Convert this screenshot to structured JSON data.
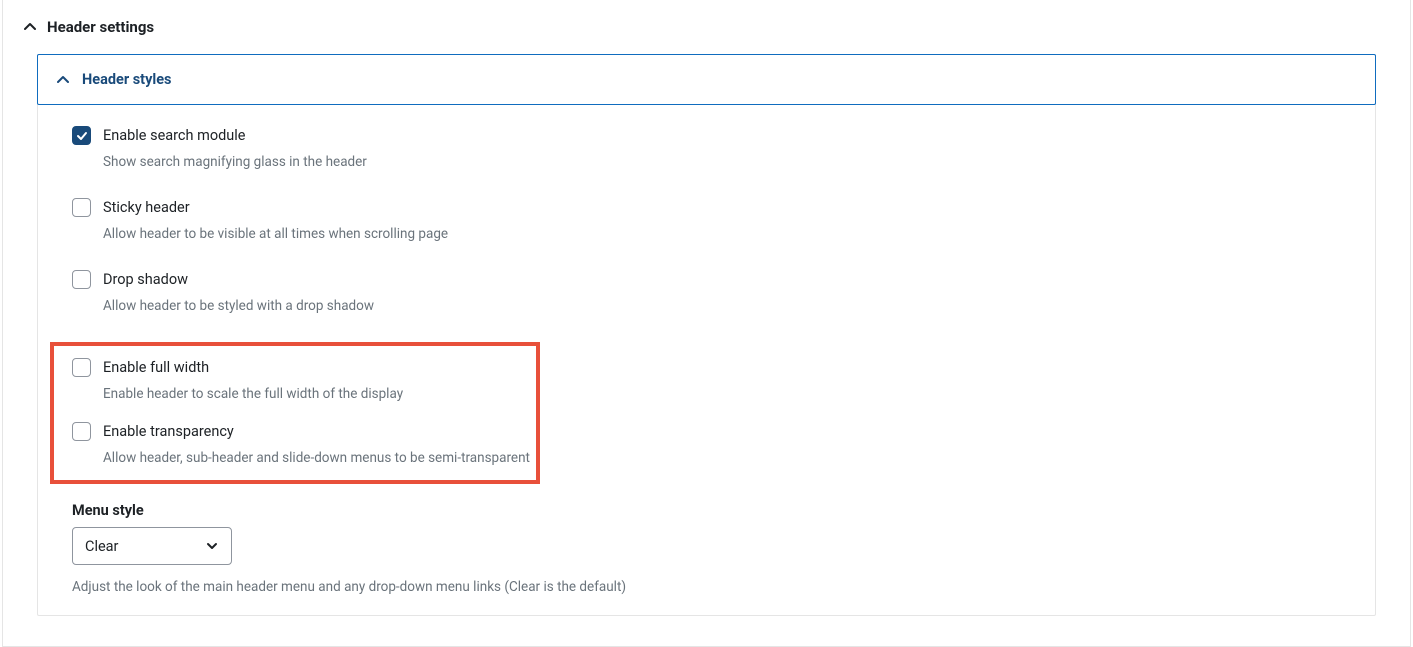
{
  "header": {
    "title": "Header settings"
  },
  "sub": {
    "title": "Header styles"
  },
  "options": {
    "enable_search": {
      "label": "Enable search module",
      "desc": "Show search magnifying glass in the header",
      "checked": true
    },
    "sticky_header": {
      "label": "Sticky header",
      "desc": "Allow header to be visible at all times when scrolling page",
      "checked": false
    },
    "drop_shadow": {
      "label": "Drop shadow",
      "desc": "Allow header to be styled with a drop shadow",
      "checked": false
    },
    "full_width": {
      "label": "Enable full width",
      "desc": "Enable header to scale the full width of the display",
      "checked": false
    },
    "transparency": {
      "label": "Enable transparency",
      "desc": "Allow header, sub-header and slide-down menus to be semi-transparent",
      "checked": false
    }
  },
  "menu_style": {
    "label": "Menu style",
    "selected": "Clear",
    "desc": "Adjust the look of the main header menu and any drop-down menu links (Clear is the default)"
  }
}
